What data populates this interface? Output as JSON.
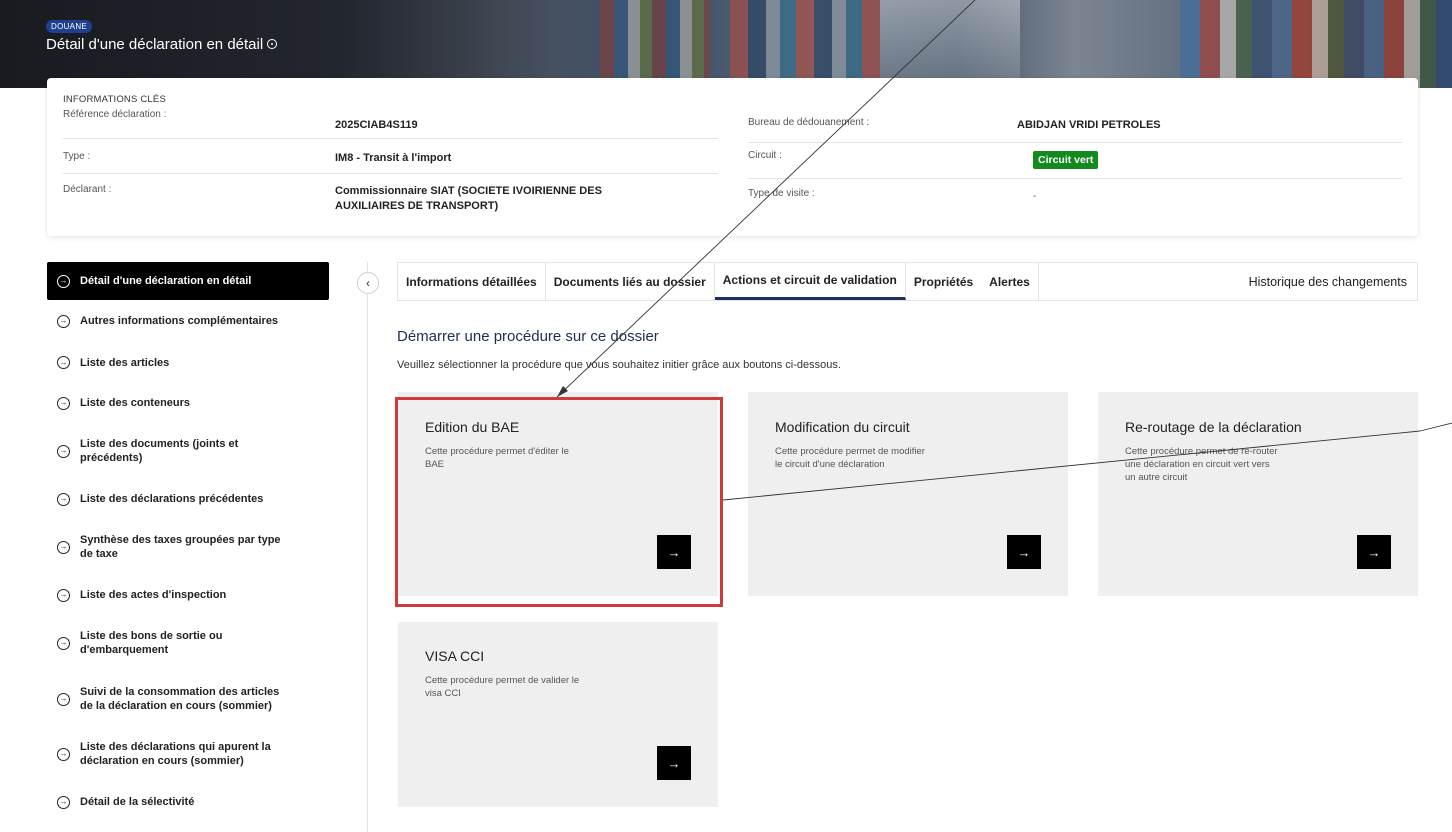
{
  "header": {
    "badge": "DOUANE",
    "title": "Détail d'une déclaration en détail"
  },
  "key_info": {
    "section_title": "INFORMATIONS CLÉS",
    "reference_label": "Référence déclaration :",
    "reference_value": "2025CIAB4S119",
    "type_label": "Type :",
    "type_value": "IM8 - Transit à l'import",
    "declarant_label": "Déclarant :",
    "declarant_value_line1": "Commissionnaire SIAT (SOCIETE IVOIRIENNE DES",
    "declarant_value_line2": "AUXILIAIRES DE TRANSPORT)",
    "bureau_label": "Bureau de dédouanement :",
    "bureau_value": "ABIDJAN VRIDI PETROLES",
    "circuit_label": "Circuit :",
    "circuit_value": "Circuit vert",
    "circuit_color": "#138a1e",
    "visit_label": "Type de visite :",
    "visit_value": "-"
  },
  "sidebar": {
    "items": [
      {
        "label": "Détail d'une déclaration en détail"
      },
      {
        "label": "Autres informations complémentaires"
      },
      {
        "label": "Liste des articles"
      },
      {
        "label": "Liste des conteneurs"
      },
      {
        "line1": "Liste des documents (joints et",
        "line2": "précédents)"
      },
      {
        "label": "Liste des déclarations précédentes"
      },
      {
        "line1": "Synthèse des taxes groupées par type",
        "line2": "de taxe"
      },
      {
        "label": "Liste des actes d'inspection"
      },
      {
        "line1": "Liste des bons de sortie ou",
        "line2": "d'embarquement"
      },
      {
        "line1": "Suivi de la consommation des articles",
        "line2": "de la déclaration en cours (sommier)"
      },
      {
        "line1": "Liste des déclarations qui apurent la",
        "line2": "déclaration en cours (sommier)"
      },
      {
        "label": "Détail de la sélectivité"
      }
    ]
  },
  "tabs": [
    {
      "label": "Informations détaillées"
    },
    {
      "label": "Documents liés au dossier"
    },
    {
      "label": "Actions et circuit de validation"
    },
    {
      "label": "Propriétés"
    },
    {
      "label": "Alertes"
    },
    {
      "label": "Historique des changements"
    }
  ],
  "main": {
    "title": "Démarrer une procédure sur ce dossier",
    "subtitle": "Veuillez sélectionner la procédure que vous souhaitez initier grâce aux boutons ci-dessous."
  },
  "cards": [
    {
      "title": "Edition du BAE",
      "desc_line1": "Cette procédure permet d'éditer le",
      "desc_line2": "BAE",
      "desc_line3": "",
      "button": "→"
    },
    {
      "title": "Modification du circuit",
      "desc_line1": "Cette procédure permet de modifier",
      "desc_line2": "le circuit d'une déclaration",
      "desc_line3": "",
      "button": "→"
    },
    {
      "title": "Re-routage de la déclaration",
      "desc_line1": "Cette procédure permet de re-router",
      "desc_line2": "une déclaration en circuit vert vers",
      "desc_line3": "un autre circuit",
      "button": "→"
    },
    {
      "title": "VISA CCI",
      "desc_line1": "Cette procédure permet de valider le",
      "desc_line2": "visa CCI",
      "desc_line3": "",
      "button": "→"
    }
  ],
  "icons": {
    "sidebar_arrow": "arrow-circle-right-icon",
    "collapse": "chevron-left-icon",
    "card_button": "arrow-right-icon",
    "title_info": "info-circle-icon"
  },
  "colors": {
    "highlight_border": "#cf3b3b",
    "active_tab_underline": "#1d2f5f",
    "section_title": "#1c2e55",
    "badge": "#1f3f8f"
  }
}
